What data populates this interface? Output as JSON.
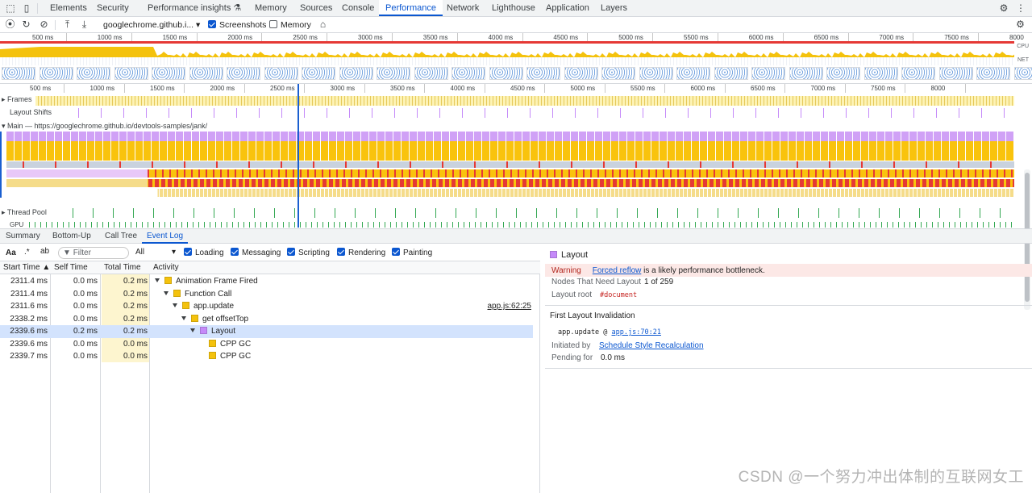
{
  "devtools": {
    "tabs": [
      "Elements",
      "Security",
      "Performance insights ⚗",
      "Memory",
      "Sources",
      "Console",
      "Performance",
      "Network",
      "Lighthouse",
      "Application",
      "Layers"
    ],
    "active_tab": "Performance",
    "icons": [
      "inspect-element-icon",
      "device-toolbar-icon"
    ],
    "settings_icon": "gear-icon",
    "more_icon": "kebab-menu-icon"
  },
  "toolbar": {
    "recording_select": "googlechrome.github.i...",
    "screenshots_label": "Screenshots",
    "screenshots_checked": true,
    "memory_label": "Memory",
    "memory_checked": false
  },
  "overview": {
    "ticks": [
      "500 ms",
      "1000 ms",
      "1500 ms",
      "2000 ms",
      "2500 ms",
      "3000 ms",
      "3500 ms",
      "4000 ms",
      "4500 ms",
      "5000 ms",
      "5500 ms",
      "6000 ms",
      "6500 ms",
      "7000 ms",
      "7500 ms",
      "8000"
    ],
    "cpu_label": "CPU",
    "net_label": "NET"
  },
  "timeline": {
    "ticks": [
      "500 ms",
      "1000 ms",
      "1500 ms",
      "2000 ms",
      "2500 ms",
      "3000 ms",
      "3500 ms",
      "4000 ms",
      "4500 ms",
      "5000 ms",
      "5500 ms",
      "6000 ms",
      "6500 ms",
      "7000 ms",
      "7500 ms",
      "8000"
    ],
    "frames_label": "Frames",
    "layout_shifts_label": "Layout Shifts",
    "main_label": "Main — https://googlechrome.github.io/devtools-samples/jank/",
    "thread_pool_label": "Thread Pool",
    "gpu_label": "GPU"
  },
  "bottom_tabs": [
    "Summary",
    "Bottom-Up",
    "Call Tree",
    "Event Log"
  ],
  "bottom_active": "Event Log",
  "filterbar": {
    "case_label": "Aa",
    "regex_label": ".*",
    "filter_placeholder": "Filter",
    "duration_select": "All",
    "categories": [
      {
        "label": "Loading",
        "checked": true
      },
      {
        "label": "Messaging",
        "checked": true
      },
      {
        "label": "Scripting",
        "checked": true
      },
      {
        "label": "Rendering",
        "checked": true
      },
      {
        "label": "Painting",
        "checked": true
      }
    ]
  },
  "event_log": {
    "columns": [
      "Start Time",
      "Self Time",
      "Total Time",
      "Activity"
    ],
    "rows": [
      {
        "start": "2311.4 ms",
        "self": "0.0 ms",
        "total": "0.2 ms",
        "activity": "Animation Frame Fired",
        "depth": 0,
        "color": "#f4c20d",
        "link": ""
      },
      {
        "start": "2311.4 ms",
        "self": "0.0 ms",
        "total": "0.2 ms",
        "activity": "Function Call",
        "depth": 1,
        "color": "#f4c20d",
        "link": ""
      },
      {
        "start": "2311.6 ms",
        "self": "0.0 ms",
        "total": "0.2 ms",
        "activity": "app.update",
        "depth": 2,
        "color": "#f4c20d",
        "link": "app.js:62:25"
      },
      {
        "start": "2338.2 ms",
        "self": "0.0 ms",
        "total": "0.2 ms",
        "activity": "get offsetTop",
        "depth": 3,
        "color": "#f4c20d",
        "link": ""
      },
      {
        "start": "2339.6 ms",
        "self": "0.2 ms",
        "total": "0.2 ms",
        "activity": "Layout",
        "depth": 4,
        "color": "#c58af9",
        "link": "",
        "selected": true
      },
      {
        "start": "2339.6 ms",
        "self": "0.0 ms",
        "total": "0.0 ms",
        "activity": "CPP GC",
        "depth": 5,
        "color": "#f4c20d",
        "link": ""
      },
      {
        "start": "2339.7 ms",
        "self": "0.0 ms",
        "total": "0.0 ms",
        "activity": "CPP GC",
        "depth": 5,
        "color": "#f4c20d",
        "link": ""
      }
    ]
  },
  "summary": {
    "title": "Layout",
    "title_color": "#c58af9",
    "warning_label": "Warning",
    "warning_link": "Forced reflow",
    "warning_text": " is a likely performance bottleneck.",
    "nodes_label": "Nodes That Need Layout",
    "nodes_value": "1 of 259",
    "root_label": "Layout root",
    "root_value": "#document",
    "invalidation_heading": "First Layout Invalidation",
    "stack_fn": "app.update @ ",
    "stack_link": "app.js:70:21",
    "initiated_label": "Initiated by",
    "initiated_link": "Schedule Style Recalculation",
    "pending_label": "Pending for",
    "pending_value": "0.0 ms"
  },
  "watermark": "CSDN @一个努力冲出体制的互联网女工",
  "colors": {
    "accent": "#0b57d0",
    "scripting": "#f4c20d",
    "rendering": "#c58af9",
    "long_task": "#e53935",
    "selection": "#d3e3fd",
    "warning_bg": "#fce8e6"
  }
}
